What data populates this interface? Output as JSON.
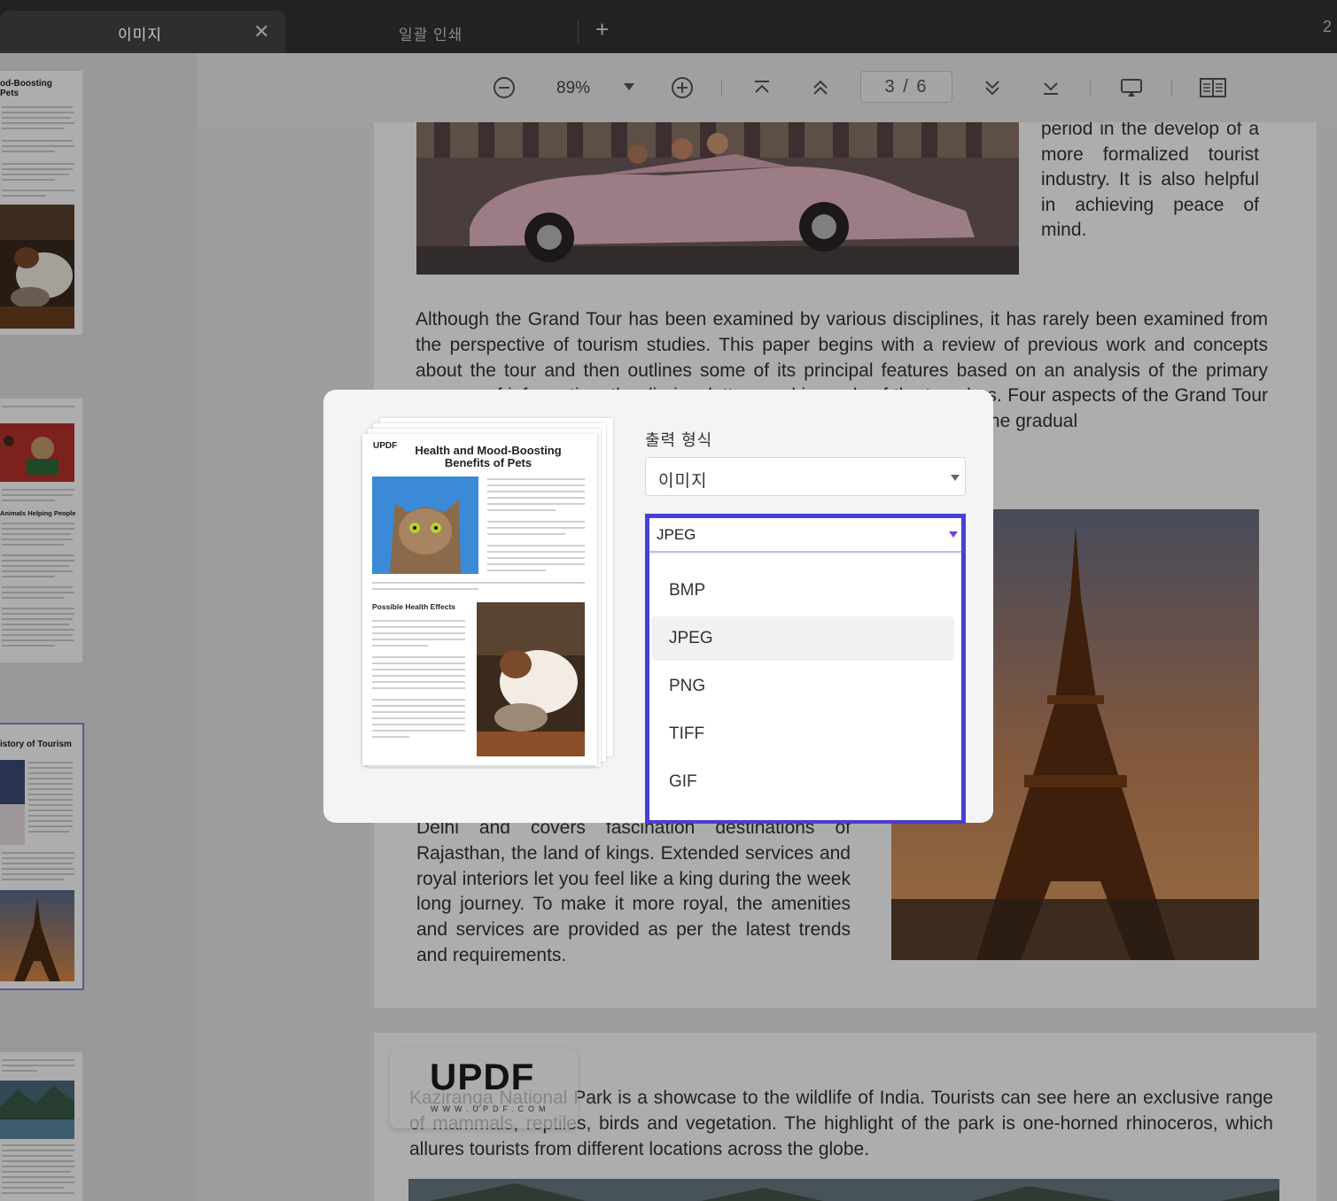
{
  "tabs": [
    {
      "label": "이미지",
      "active": true
    },
    {
      "label": "일괄 인쇄",
      "active": false
    }
  ],
  "tab_count": "2",
  "toolbar": {
    "zoom": "89%",
    "page_indicator": "3 / 6"
  },
  "sidebar": {
    "thumb1_title": "od-Boosting Pets",
    "thumb2_subtitle": "Animals Helping People",
    "thumb3_title": "istory of Tourism"
  },
  "document": {
    "right_top_text": "period in the develop of a more formalized tourist industry. It is also helpful in achieving peace of mind.",
    "main_paragraph": "Although the Grand Tour has been examined by various disciplines, it has rarely been examined from the perspective of tourism studies. This paper begins with a review of previous work and concepts about the tour and then outlines some of its principal features based on an analysis of the primary sources of information: the diaries, letters and journals of the travelers. Four aspects of the Grand Tour are examined: the tourists, the geographical patterns of the tour, and the gradual",
    "delhi_paragraph": "Delhi and covers fascination destinations of Rajasthan, the land of kings. Extended services and royal interiors let you feel like a king during the week long journey. To make it more royal, the amenities and services are provided as per the latest trends and requirements.",
    "page2_paragraph": "Kaziranga National Park is a showcase to the wildlife of India. Tourists can see here an exclusive range of mammals, reptiles, birds and vegetation. The highlight of the park is one-horned rhinoceros, which allures tourists from different locations across the globe."
  },
  "watermark": {
    "brand": "UPDF",
    "url": "WWW.UPDF.COM"
  },
  "dialog": {
    "preview": {
      "logo": "UPDF",
      "title": "Health and Mood-Boosting Benefits of Pets",
      "subheading": "Possible Health Effects"
    },
    "output_label": "출력 형식",
    "format_value": "이미지",
    "image_type_value": "JPEG",
    "image_type_options": [
      "BMP",
      "JPEG",
      "PNG",
      "TIFF",
      "GIF"
    ],
    "selected_option": "JPEG",
    "accent_color": "#4a3fd8"
  }
}
